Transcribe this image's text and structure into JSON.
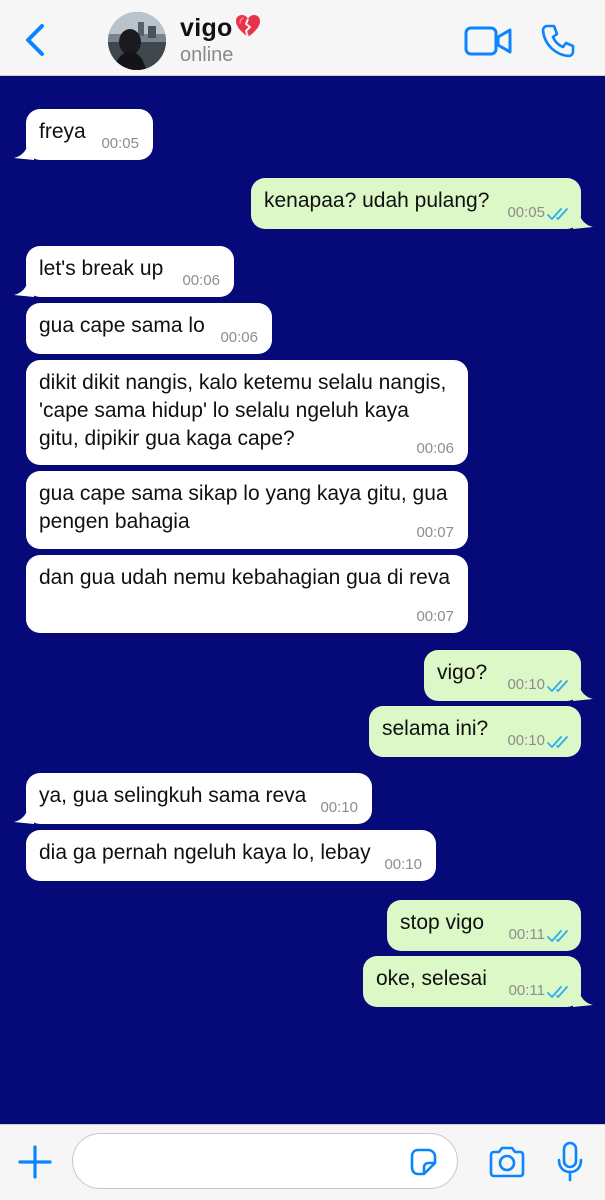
{
  "header": {
    "contact_name": "vigo",
    "status": "online",
    "icons": {
      "back": "chevron-left-icon",
      "heart": "mending-heart-icon",
      "video": "video-camera-icon",
      "call": "phone-icon"
    }
  },
  "messages": [
    {
      "direction": "in",
      "text": "freya",
      "time": "00:05"
    },
    {
      "direction": "out",
      "text": "kenapaa? udah pulang?",
      "time": "00:05",
      "status": "read"
    },
    {
      "direction": "in",
      "text": "let's break up",
      "time": "00:06"
    },
    {
      "direction": "in",
      "text": "gua cape sama lo",
      "time": "00:06"
    },
    {
      "direction": "in",
      "text": "dikit dikit nangis, kalo ketemu selalu nangis,\n'cape sama hidup' lo selalu ngeluh kaya\ngitu, dipikir gua kaga cape?",
      "time": "00:06"
    },
    {
      "direction": "in",
      "text": "gua cape sama sikap lo yang kaya gitu, gua\npengen bahagia",
      "time": "00:07"
    },
    {
      "direction": "in",
      "text": "dan gua udah nemu kebahagian gua di reva",
      "time": "00:07"
    },
    {
      "direction": "out",
      "text": "vigo?",
      "time": "00:10",
      "status": "read"
    },
    {
      "direction": "out",
      "text": "selama ini?",
      "time": "00:10",
      "status": "read"
    },
    {
      "direction": "in",
      "text": "ya, gua selingkuh sama reva",
      "time": "00:10"
    },
    {
      "direction": "in",
      "text": "dia ga pernah ngeluh kaya lo, lebay",
      "time": "00:10"
    },
    {
      "direction": "out",
      "text": "stop vigo",
      "time": "00:11",
      "status": "read"
    },
    {
      "direction": "out",
      "text": "oke, selesai",
      "time": "00:11",
      "status": "read"
    }
  ],
  "composer": {
    "value": "",
    "icons": {
      "plus": "plus-icon",
      "sticker": "sticker-icon",
      "camera": "camera-icon",
      "mic": "microphone-icon"
    }
  },
  "colors": {
    "chat_background": "#050a78",
    "incoming_bubble": "#ffffff",
    "outgoing_bubble": "#dcf8c6",
    "accent": "#0a84ff",
    "read_ticks": "#34aaf0"
  }
}
